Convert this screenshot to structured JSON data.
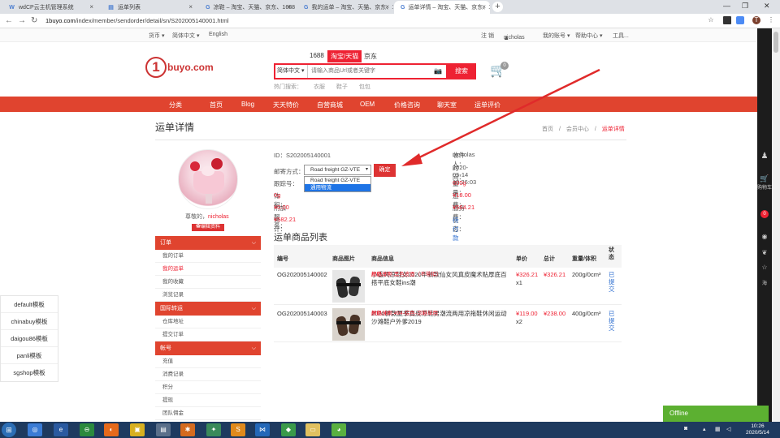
{
  "browser": {
    "tabs": [
      {
        "label": "wdCP云主机管理系统"
      },
      {
        "label": "运单列表"
      },
      {
        "label": "凉鞋 – 淘宝、天猫、京东、1688"
      },
      {
        "label": "我的运单 – 淘宝、天猫、京东、1"
      },
      {
        "label": "运单详情 – 淘宝、天猫、京东、1"
      }
    ],
    "url_domain": "1buyo.com",
    "url_path": "/index/member/sendorder/detail/sn/S202005140001.html",
    "profile_initial": "T"
  },
  "topnav": {
    "currency": "货币 ▾",
    "lang_cn": "简体中文 ▾",
    "lang_en": "English",
    "logout": "注 销",
    "user": "nicholas",
    "my_account": "我的账号 ▾",
    "help": "帮助中心 ▾",
    "tools": "工具..."
  },
  "header": {
    "logo_num": "1",
    "logo_text": "buyo.com",
    "search_tabs": [
      "1688",
      "淘宝/天猫",
      "京东"
    ],
    "search_lang": "简体中文",
    "search_placeholder": "请输入商品Url或者关键字",
    "search_button": "搜索",
    "hot_label": "热门搜索：",
    "hot_items": [
      "衣服",
      "鞋子",
      "包包"
    ],
    "cart_count": "0"
  },
  "menu": [
    "分类",
    "首页",
    "Blog",
    "天天特价",
    "自营商城",
    "OEM",
    "价格咨询",
    "聊天室",
    "运单评价"
  ],
  "page": {
    "title": "运单详情",
    "breadcrumb": [
      "首页",
      "会员中心",
      "运单详情"
    ],
    "breadcrumb_sep": "/"
  },
  "profile": {
    "greet": "尊敬的，",
    "name": "nicholas",
    "edit": "✿编辑资料"
  },
  "sidebar": [
    {
      "header": "订单",
      "items": [
        "我的订单",
        "我的运单",
        "我的收藏",
        "浏览记录"
      ]
    },
    {
      "header": "国际转运",
      "items": [
        "仓库地址",
        "提交订单"
      ]
    },
    {
      "header": "帐号",
      "items": [
        "充值",
        "消费记录",
        "积分",
        "提现",
        "团队佣金"
      ]
    }
  ],
  "templates": [
    "default模板",
    "chinabuy模板",
    "daigou86模板",
    "panli模板",
    "sgshop模板"
  ],
  "order": {
    "id": "ID：S202005140001",
    "ship_label": "邮寄方式：",
    "ship_selected": "Road freight GZ-VTE",
    "ship_options": [
      "Road freight GZ-VTE",
      "通用物流"
    ],
    "confirm": "确定",
    "tracking_label": "跟踪号：",
    "volume_label": "体积：",
    "volume_value": "0g",
    "extra_label": "附加服务：",
    "extra_value": "¥0.00",
    "total_label": "总计：",
    "total_value": "¥582.21",
    "receiver_label": "收件人：",
    "receiver_value": "nicholas",
    "time_label": "时间：",
    "time_value": "2020-05-14 10:26:03",
    "weight_label": "重量：",
    "weight_value": "600g",
    "freight_label": "运费：",
    "freight_value": "¥18.00",
    "service_label": "服务费：",
    "service_value": "¥564.21",
    "status_label": "状态：",
    "status_value": "待付款"
  },
  "goods": {
    "title": "运单商品列表",
    "headers": [
      "编号",
      "商品图片",
      "商品信息",
      "单价",
      "总计",
      "重量/体积",
      "状态"
    ],
    "rows": [
      {
        "id": "OG202005140002",
        "info": "小香风凉鞋女2020年新款仙女风真皮魔术贴厚底百搭平底女鞋ins潮",
        "size": "尺码:37",
        "color": "颜色分类:黑色皮面（不带扣）",
        "price": "¥326.21",
        "qty": "x1",
        "total": "¥326.21",
        "weight": "200g/0cm³",
        "status": "已提交"
      },
      {
        "id": "OG202005140003",
        "info": "2020新款夏季真皮凉鞋男潮流两用凉拖鞋休闲运动沙滩鞋户外爹2019",
        "size": "尺码:41",
        "color": "颜色分类:494-棕色-凉鞋单用",
        "price": "¥119.00",
        "qty": "x2",
        "total": "¥238.00",
        "weight": "400g/0cm³",
        "status": "已提交"
      }
    ]
  },
  "right_toolbar": {
    "cart_label": "购物车",
    "cart_count": "0",
    "misc_label": "海"
  },
  "offline": "Offline",
  "clock": {
    "time": "10:26",
    "date": "2020/5/14"
  }
}
